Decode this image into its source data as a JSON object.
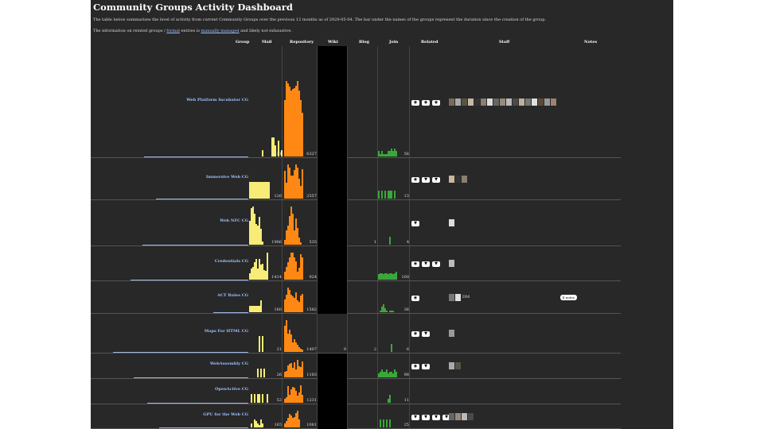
{
  "title": "Community Groups Activity Dashboard",
  "intro": {
    "line1": "The table below summarizes the level of activity from current Community Groups over the previous 12 months as of 2020-05-04. The bar under the names of the groups represent the duration since the creation of the group.",
    "line2_pre": "The information on related groups / ",
    "line2_link1": "formal",
    "line2_mid": " entries is ",
    "line2_link2": "manually managed",
    "line2_post": " and likely not exhaustive."
  },
  "columns": [
    "Group",
    "Mail",
    "Repository",
    "Wiki",
    "Blog",
    "Join",
    "Related",
    "Staff",
    "Notes"
  ],
  "colors": {
    "mail": "#f7ec77",
    "repository": "#ff8814",
    "join": "#39a839",
    "duration": "#9fb8e6"
  },
  "groups": [
    {
      "name": "Web Platform Incubator CG",
      "mail": 531,
      "repository": 6327,
      "wiki": "",
      "blog": "",
      "join": 56,
      "duration_fraction": 0.77,
      "mail_series": [
        0,
        0,
        0,
        0,
        0,
        0,
        0,
        0,
        5,
        0,
        0,
        0,
        0,
        0,
        14,
        14,
        8,
        0,
        12,
        0,
        5,
        0
      ],
      "repo_series": [
        75,
        100,
        97,
        93,
        87,
        89,
        91,
        94,
        100,
        87,
        75,
        58
      ],
      "join_series": [
        2,
        1,
        2,
        1,
        1,
        1,
        2,
        2,
        3,
        2,
        3,
        2
      ],
      "wiki_black": true,
      "related_icons": [
        "github-icon",
        "github-icon",
        "github-icon"
      ],
      "staff_count": 17,
      "staff_initials": "",
      "note": ""
    },
    {
      "name": "Immersive Web CG",
      "mail": 126,
      "repository": 2557,
      "wiki": "",
      "blog": "",
      "join": 13,
      "duration_fraction": 0.68,
      "mail_series": [
        1,
        1,
        1,
        1,
        1,
        1,
        1,
        1,
        1,
        1,
        1,
        1,
        1
      ],
      "repo_series": [
        37,
        21,
        46,
        42,
        31,
        31,
        38,
        46,
        42,
        27,
        17,
        40
      ],
      "join_series": [
        1,
        0,
        1,
        0,
        1,
        0,
        1,
        1,
        1,
        0,
        1,
        0
      ],
      "wiki_black": true,
      "related_icons": [
        "github-icon",
        "w3c-icon",
        "w3c-icon"
      ],
      "staff_count": 3,
      "staff_initials": "",
      "note": ""
    },
    {
      "name": "Web NFC CG",
      "mail": 1966,
      "repository": 535,
      "wiki": "",
      "blog": "1",
      "join": 4,
      "duration_fraction": 0.78,
      "mail_series": [
        36,
        55,
        57,
        46,
        31,
        28,
        42,
        24,
        5,
        0,
        0
      ],
      "repo_series": [
        2,
        6,
        8,
        12,
        16,
        13,
        6,
        11,
        7,
        3,
        1,
        0
      ],
      "join_series": [
        0,
        0,
        0,
        0,
        0,
        0,
        0,
        1,
        0,
        0,
        0,
        0
      ],
      "wiki_black": true,
      "related_icons": [
        "w3c-icon"
      ],
      "staff_count": 1,
      "staff_initials": "",
      "note": ""
    },
    {
      "name": "Credentials CG",
      "mail": 1414,
      "repository": 924,
      "wiki": "",
      "blog": "",
      "join": 100,
      "duration_fraction": 0.87,
      "mail_series": [
        9,
        16,
        19,
        26,
        31,
        16,
        31,
        22,
        24,
        14,
        13,
        40
      ],
      "repo_series": [
        8,
        13,
        18,
        23,
        28,
        28,
        23,
        19,
        8,
        12,
        26,
        23
      ],
      "join_series": [
        4,
        5,
        5,
        4,
        5,
        5,
        4,
        5,
        5,
        4,
        5,
        6
      ],
      "wiki_black": true,
      "related_icons": [
        "github-icon",
        "w3c-icon",
        "w3c-icon"
      ],
      "staff_count": 1,
      "staff_initials": "",
      "note": ""
    },
    {
      "name": "ACT Rules CG",
      "mail": 160,
      "repository": 1582,
      "wiki": "",
      "blog": "",
      "join": 36,
      "duration_fraction": 0.26,
      "mail_series": [
        1,
        1,
        1,
        1,
        1,
        1,
        1,
        2
      ],
      "repo_series": [
        17,
        23,
        32,
        29,
        23,
        21,
        19,
        26,
        15,
        13,
        22,
        24
      ],
      "join_series": [
        0,
        1,
        3,
        4,
        2,
        1,
        0,
        1,
        1,
        1,
        0,
        0
      ],
      "wiki_black": true,
      "related_icons": [
        "github-icon"
      ],
      "staff_count": 2,
      "staff_initials": "DM",
      "note": "ll notes"
    },
    {
      "name": "Maps For HTML CG",
      "mail": 21,
      "repository": 1407,
      "wiki": "9",
      "blog": "2",
      "join": 6,
      "duration_fraction": 1.0,
      "mail_series": [
        0,
        0,
        0,
        0,
        0,
        0,
        1,
        0,
        1,
        0,
        0,
        0
      ],
      "repo_series": [
        40,
        48,
        28,
        34,
        26,
        15,
        19,
        14,
        11,
        7,
        5,
        4
      ],
      "join_series": [
        0,
        0,
        0,
        0,
        0,
        0,
        0,
        0,
        1,
        0,
        0,
        0
      ],
      "wiki_black": false,
      "related_icons": [
        "github-icon",
        "w3c-icon"
      ],
      "staff_count": 1,
      "staff_initials": "",
      "note": ""
    },
    {
      "name": "WebAssembly CG",
      "mail": 26,
      "repository": 1183,
      "wiki": "",
      "blog": "",
      "join": 98,
      "duration_fraction": 0.85,
      "mail_series": [
        0,
        0,
        0,
        0,
        0,
        1,
        0,
        1,
        0,
        1,
        0,
        0
      ],
      "repo_series": [
        8,
        10,
        18,
        20,
        21,
        14,
        23,
        12,
        26,
        16,
        15,
        24
      ],
      "join_series": [
        2,
        3,
        4,
        3,
        3,
        4,
        2,
        3,
        3,
        2,
        4,
        3
      ],
      "wiki_black": true,
      "related_icons": [
        "github-icon",
        "w3c-icon"
      ],
      "staff_count": 2,
      "staff_initials": "",
      "note": ""
    },
    {
      "name": "OpenActive CG",
      "mail": 52,
      "repository": 1231,
      "wiki": "",
      "blog": "",
      "join": 11,
      "duration_fraction": 0.75,
      "mail_series": [
        0,
        1,
        0,
        1,
        0,
        1,
        1,
        0,
        1,
        0,
        0,
        1
      ],
      "repo_series": [
        6,
        9,
        27,
        13,
        22,
        26,
        24,
        19,
        12,
        17,
        28,
        13
      ],
      "join_series": [
        0,
        0,
        0,
        0,
        0,
        0,
        1,
        2,
        0,
        0,
        0,
        0
      ],
      "wiki_black": true,
      "related_icons": [],
      "staff_count": 0,
      "staff_initials": "",
      "note": ""
    },
    {
      "name": "GPU for the Web CG",
      "mail": 165,
      "repository": 1081,
      "wiki": "",
      "blog": "",
      "join": 25,
      "duration_fraction": 0.66,
      "mail_series": [
        0,
        2,
        0,
        4,
        3,
        2,
        1,
        4,
        2
      ],
      "repo_series": [
        6,
        10,
        14,
        20,
        18,
        14,
        16,
        22,
        25,
        12
      ],
      "join_series": [
        0,
        1,
        0,
        1,
        0,
        1,
        0,
        1,
        0,
        0
      ],
      "wiki_black": true,
      "related_icons": [
        "w3c-icon",
        "w3c-icon",
        "w3c-icon",
        "w3c-icon"
      ],
      "staff_count": 4,
      "staff_initials": "",
      "note": ""
    }
  ]
}
